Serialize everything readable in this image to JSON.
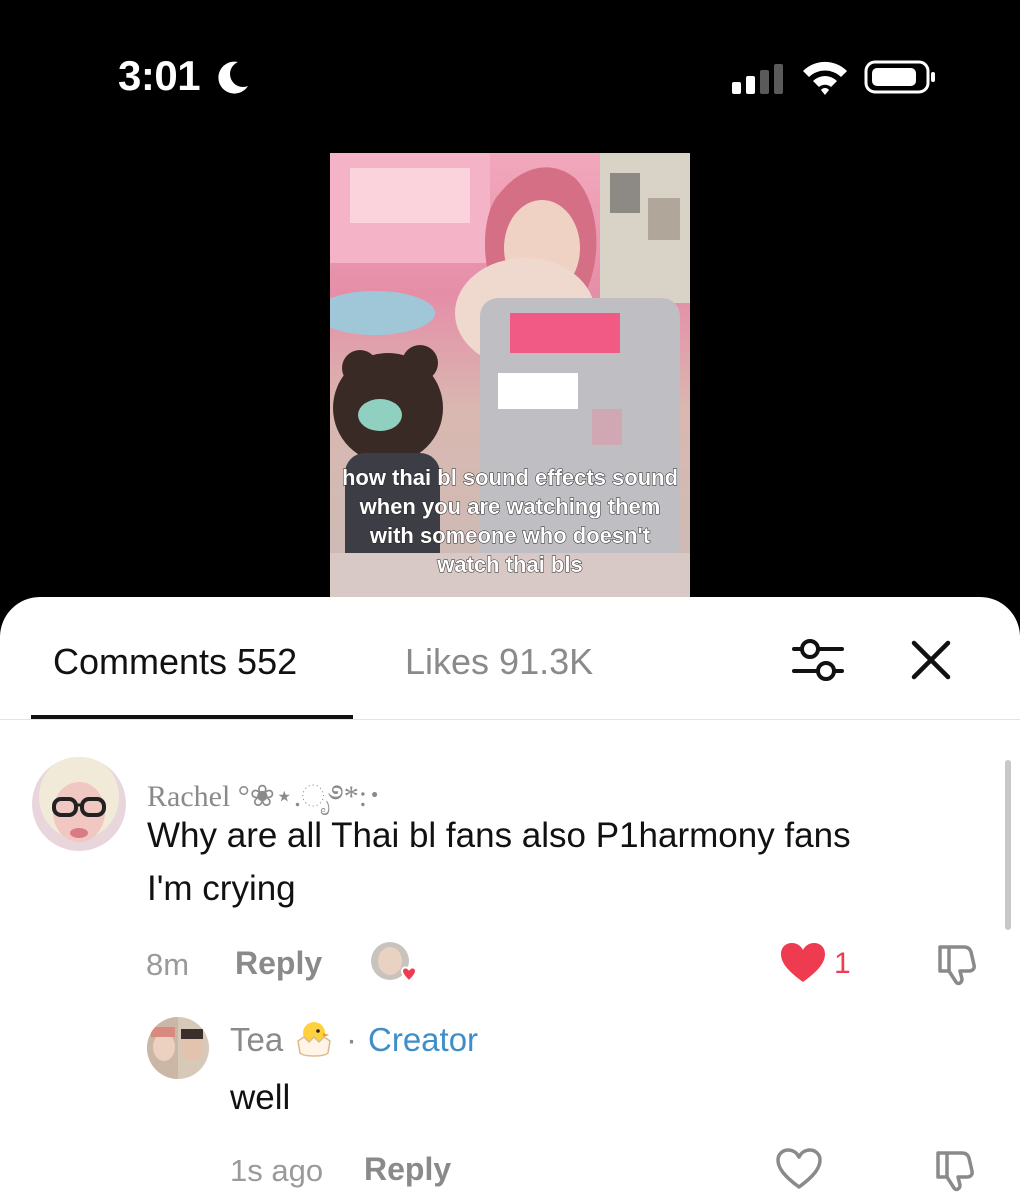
{
  "status_bar": {
    "time": "3:01"
  },
  "video": {
    "caption": "how thai bl sound effects sound when you are watching them with someone who doesn't watch thai bls"
  },
  "sheet": {
    "tabs": [
      {
        "label": "Comments 552"
      },
      {
        "label": "Likes 91.3K"
      }
    ]
  },
  "comments": [
    {
      "username": "Rachel °❀⋆.ೃ࿔*:･",
      "text_line1": "Why are all Thai bl fans also P1harmony fans",
      "text_line2": "I'm crying",
      "time": "8m",
      "reply_label": "Reply",
      "like_count": "1",
      "liked": true
    },
    {
      "username": "Tea",
      "badge_sep": "·",
      "badge": "Creator",
      "text": "well",
      "time": "1s ago",
      "reply_label": "Reply",
      "liked": false
    }
  ],
  "colors": {
    "accent_red": "#ef3b4f",
    "creator_blue": "#3e8fc9"
  }
}
